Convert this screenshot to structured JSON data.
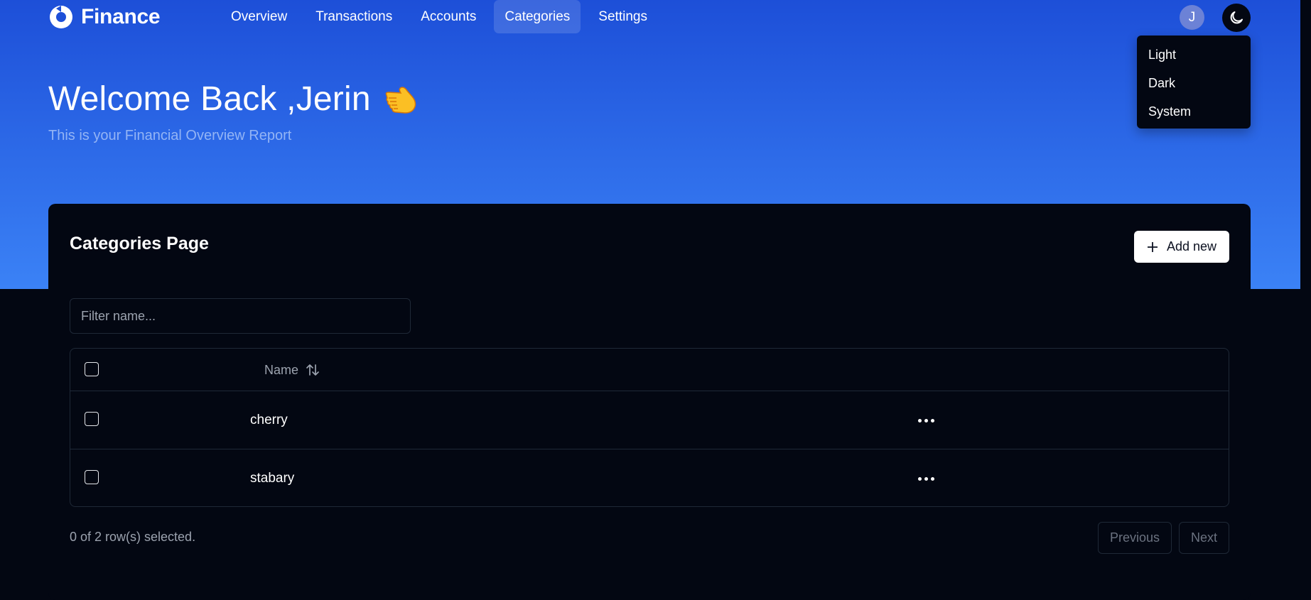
{
  "brand": {
    "name": "Finance"
  },
  "nav": {
    "items": [
      {
        "label": "Overview",
        "active": false
      },
      {
        "label": "Transactions",
        "active": false
      },
      {
        "label": "Accounts",
        "active": false
      },
      {
        "label": "Categories",
        "active": true
      },
      {
        "label": "Settings",
        "active": false
      }
    ]
  },
  "user": {
    "initial": "J"
  },
  "theme_menu": {
    "icon": "moon-icon",
    "options": [
      "Light",
      "Dark",
      "System"
    ]
  },
  "welcome": {
    "heading": "Welcome Back ,Jerin",
    "emoji_icon": "waving-hand-icon",
    "subtitle": "This is your Financial Overview Report"
  },
  "page": {
    "title": "Categories Page",
    "add_button_label": "Add new",
    "filter_placeholder": "Filter name..."
  },
  "table": {
    "columns": {
      "name": "Name"
    },
    "rows": [
      {
        "name": "cherry"
      },
      {
        "name": "stabary"
      }
    ]
  },
  "footer": {
    "selected_text": "0 of 2 row(s) selected.",
    "previous_label": "Previous",
    "next_label": "Next"
  },
  "colors": {
    "hero_top": "#1d4fd8",
    "hero_bottom": "#3b82f6",
    "background": "#030712",
    "border": "#1f2937"
  }
}
